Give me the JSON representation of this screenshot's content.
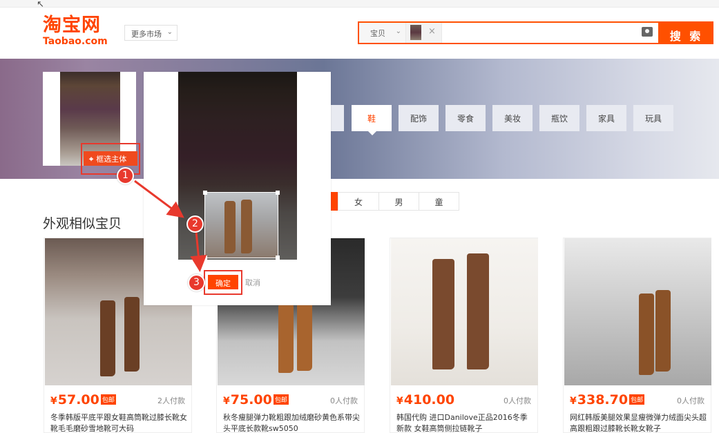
{
  "header": {
    "logo_cn": "淘宝网",
    "logo_en": "Taobao.com",
    "market_label": "更多市场",
    "search_scope": "宝贝",
    "search_button": "搜 索",
    "remove_image_symbol": "×"
  },
  "image_search": {
    "crop_button_label": "框选主体",
    "confirm_label": "确定",
    "cancel_label": "取消",
    "steps": [
      "1",
      "2",
      "3"
    ]
  },
  "categories": [
    {
      "label": "鞋",
      "active": true
    },
    {
      "label": "配饰",
      "active": false
    },
    {
      "label": "零食",
      "active": false
    },
    {
      "label": "美妆",
      "active": false
    },
    {
      "label": "瓶饮",
      "active": false
    },
    {
      "label": "家具",
      "active": false
    },
    {
      "label": "玩具",
      "active": false
    }
  ],
  "gender_filter": [
    "女",
    "男",
    "童"
  ],
  "section_title": "外观相似宝贝",
  "products": [
    {
      "currency": "¥",
      "price": "57.00",
      "badge": "包邮",
      "paid": "2人付款",
      "title": "冬季韩版平底平跟女鞋高筒靴过膝长靴女靴毛毛磨砂雪地靴可大码"
    },
    {
      "currency": "¥",
      "price": "75.00",
      "badge": "包邮",
      "paid": "0人付款",
      "title": "秋冬瘦腿弹力靴粗跟加绒磨砂黄色系带尖头平底长款靴sw5050"
    },
    {
      "currency": "¥",
      "price": "410.00",
      "badge": "",
      "paid": "0人付款",
      "title": "韩国代购 进口Danilove正品2016冬季新款 女鞋高筒侧拉链靴子"
    },
    {
      "currency": "¥",
      "price": "338.70",
      "badge": "包邮",
      "paid": "0人付款",
      "title": "网红韩版美腿效果显瘦微弹力绒面尖头超高跟粗跟过膝靴长靴女靴子"
    }
  ],
  "colors": {
    "brand": "#ff4400",
    "annotation": "#e8392d"
  }
}
